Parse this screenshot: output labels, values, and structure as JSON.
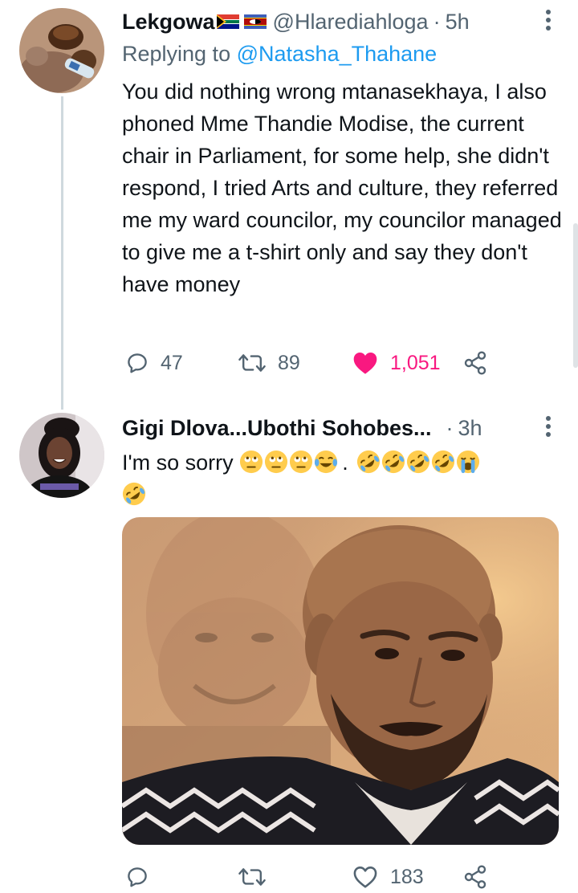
{
  "tweets": [
    {
      "name": "Lekgowa",
      "handle": "@Hlarediahloga",
      "separator": "·",
      "time": "5h",
      "reply_prefix": "Replying to",
      "reply_to": "@Natasha_Thahane",
      "text": "You did nothing wrong mtanasekhaya, I also phoned Mme Thandie Modise, the current chair in Parliament, for some help, she didn't respond, I tried Arts and culture, they referred me my ward councilor, my councilor managed to give me a t-shirt only and say they don't have money",
      "actions": {
        "replies": "47",
        "retweets": "89",
        "likes": "1,051"
      },
      "liked": true
    },
    {
      "name": "Gigi Dlova...Ubothi Sohobes...",
      "separator": "·",
      "time": "3h",
      "text": "I'm so sorry",
      "text_mid": ".",
      "emoji_sequence": [
        "rolling-eyes-face",
        "rolling-eyes-face",
        "rolling-eyes-face",
        "tears-of-joy-face",
        "rolling-on-floor-laughing-face",
        "rolling-on-floor-laughing-face",
        "rolling-on-floor-laughing-face",
        "rolling-on-floor-laughing-face",
        "loudly-crying-face",
        "rolling-on-floor-laughing-face"
      ],
      "media": "photo",
      "actions": {
        "replies": "",
        "retweets": "",
        "likes": "183"
      },
      "liked": false
    }
  ],
  "colors": {
    "text": "#0f1419",
    "secondary": "#536471",
    "link": "#1d9bf0",
    "like": "#f91880",
    "thread_line": "#cfd9de"
  }
}
